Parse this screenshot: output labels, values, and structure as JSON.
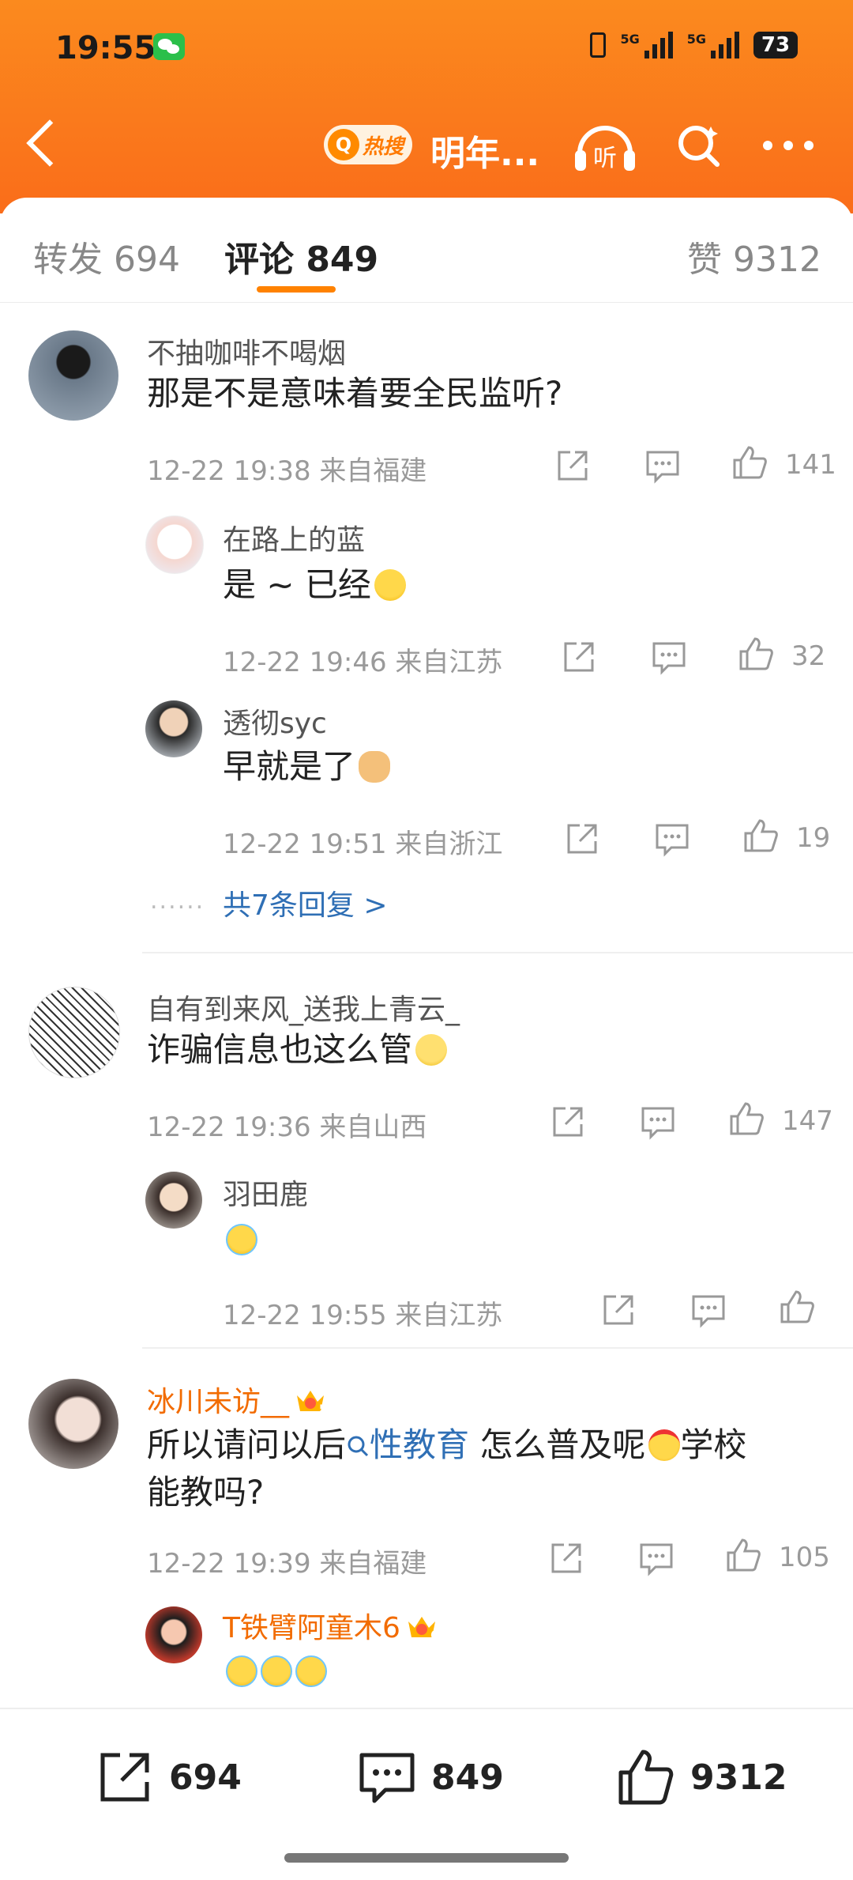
{
  "status_bar": {
    "time": "19:55",
    "signal1_label": "5G",
    "signal2_label": "5G",
    "battery": "73",
    "icons": [
      "wechat-icon",
      "vibrate-icon",
      "signal-icon",
      "battery-icon"
    ]
  },
  "nav": {
    "hot_label": "热搜",
    "title": "明年...",
    "listen_label": "听",
    "icons": [
      "back-icon",
      "listen-icon",
      "search-icon",
      "more-icon"
    ]
  },
  "tabs": [
    {
      "label": "转发 694"
    },
    {
      "label": "评论 849",
      "active": true
    },
    {
      "label": "赞 9312"
    }
  ],
  "accent_color": "#ff8200",
  "comments": [
    {
      "user": "不抽咖啡不喝烟",
      "text": "那是不是意味着要全民监听?",
      "time": "12-22 19:38 来自福建",
      "likes": "141",
      "replies": [
        {
          "user": "在路上的蓝",
          "text": "是 ~ 已经",
          "emoji": "laugh-emoji",
          "time": "12-22 19:46 来自江苏",
          "likes": "32"
        },
        {
          "user": "透彻syc",
          "text": "早就是了",
          "emoji": "doge-emoji",
          "time": "12-22 19:51 来自浙江",
          "likes": "19"
        }
      ],
      "more_replies": "共7条回复 >"
    },
    {
      "user": "自有到来风_送我上青云_",
      "text": "诈骗信息也这么管",
      "emoji": "smile-emoji",
      "time": "12-22 19:36 来自山西",
      "likes": "147",
      "replies": [
        {
          "user": "羽田鹿",
          "text": "",
          "emoji": "cry-emoji",
          "time": "12-22 19:55 来自江苏",
          "likes": ""
        }
      ]
    },
    {
      "user": "冰川未访__",
      "vip_level": "5",
      "text_before": "所以请问以后",
      "topic": "性教育",
      "text_after": " 怎么普及呢",
      "text_after2": "学校",
      "text_line2": "能教吗?",
      "time": "12-22 19:39 来自福建",
      "likes": "105",
      "replies": [
        {
          "user": "T铁臂阿童木6",
          "vip_level": "6",
          "text": "",
          "emoji": "cry-emoji x3"
        }
      ]
    }
  ],
  "bottom_bar": {
    "repost": "694",
    "comment": "849",
    "like": "9312"
  }
}
